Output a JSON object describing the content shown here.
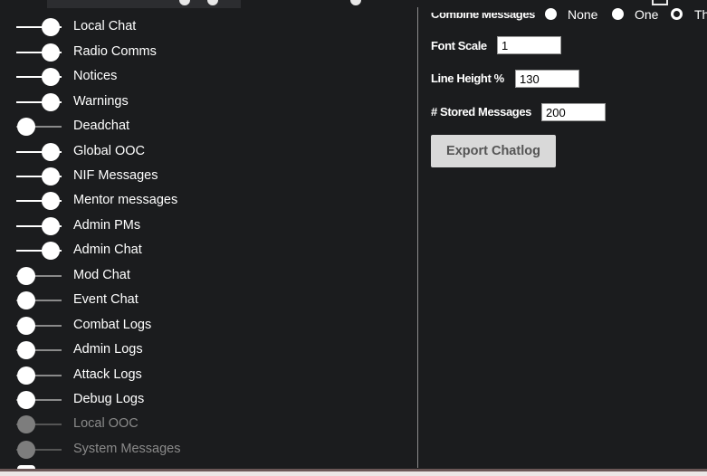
{
  "toggles": [
    {
      "label": "Local Chat",
      "state": "on"
    },
    {
      "label": "Radio Comms",
      "state": "on"
    },
    {
      "label": "Notices",
      "state": "on"
    },
    {
      "label": "Warnings",
      "state": "on"
    },
    {
      "label": "Deadchat",
      "state": "off"
    },
    {
      "label": "Global OOC",
      "state": "on"
    },
    {
      "label": "NIF Messages",
      "state": "on"
    },
    {
      "label": "Mentor messages",
      "state": "on"
    },
    {
      "label": "Admin PMs",
      "state": "on"
    },
    {
      "label": "Admin Chat",
      "state": "on"
    },
    {
      "label": "Mod Chat",
      "state": "off"
    },
    {
      "label": "Event Chat",
      "state": "off"
    },
    {
      "label": "Combat Logs",
      "state": "off"
    },
    {
      "label": "Admin Logs",
      "state": "off"
    },
    {
      "label": "Attack Logs",
      "state": "off"
    },
    {
      "label": "Debug Logs",
      "state": "off"
    },
    {
      "label": "Local OOC",
      "state": "disabled"
    },
    {
      "label": "System Messages",
      "state": "disabled"
    }
  ],
  "settings": {
    "combine_label": "Combine Messages",
    "combine_options": [
      "None",
      "One",
      "Th"
    ],
    "combine_selected": "Th",
    "font_scale_label": "Font Scale",
    "font_scale_value": "1",
    "line_height_label": "Line Height %",
    "line_height_value": "130",
    "stored_label": "# Stored Messages",
    "stored_value": "200",
    "export_label": "Export Chatlog"
  }
}
